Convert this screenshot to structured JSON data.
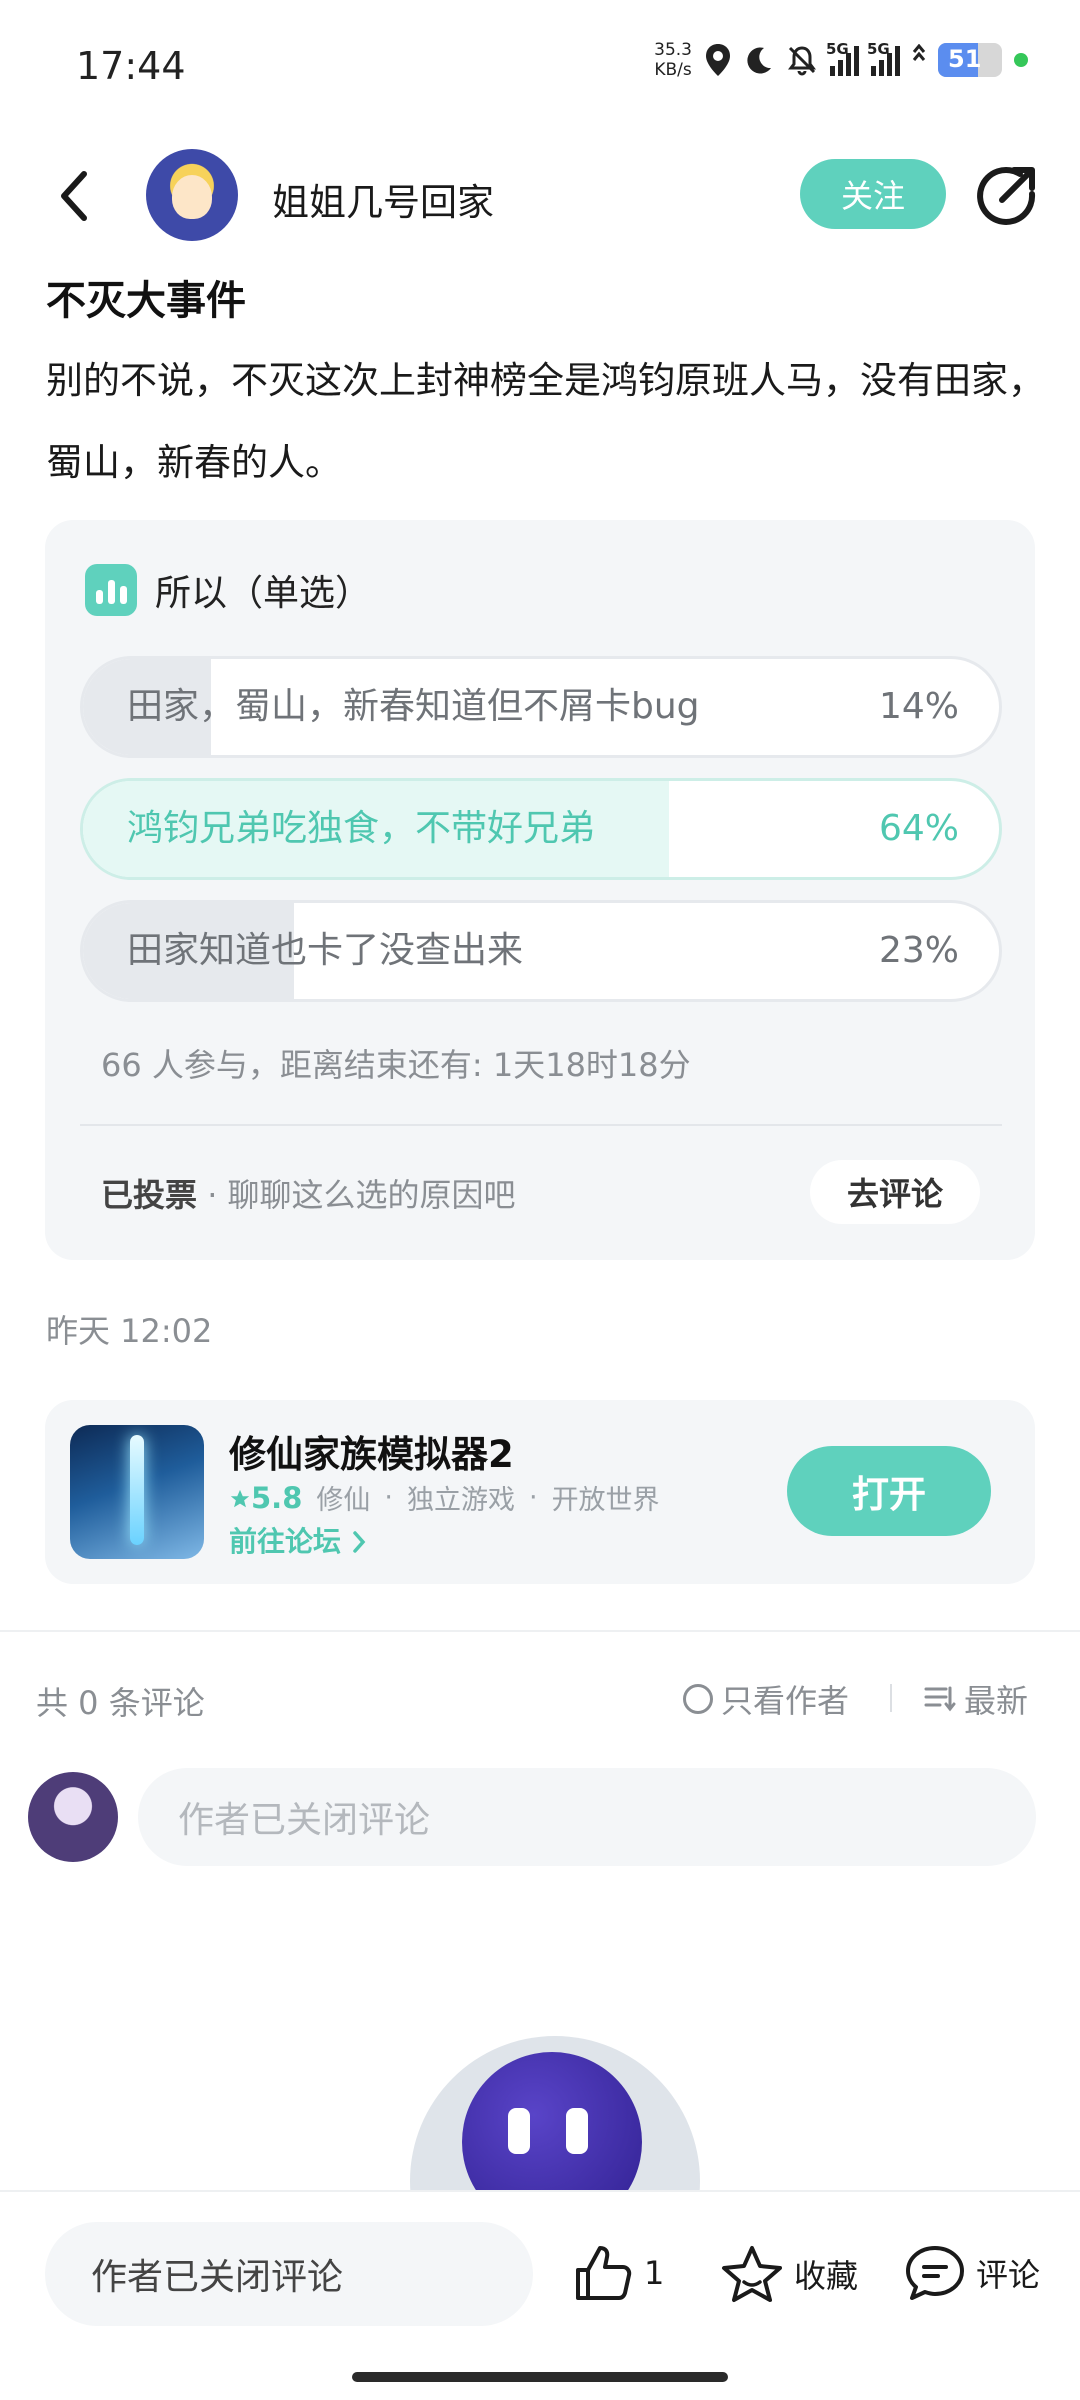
{
  "status_bar": {
    "time": "17:44",
    "net_speed_value": "35.3",
    "net_speed_unit": "KB/s",
    "sim1_type": "5G",
    "sim2_type": "5G",
    "battery_level": "51",
    "icons": [
      "location-icon",
      "moon-icon",
      "bell-off-icon",
      "signal-icon",
      "wifi-icon",
      "battery-icon"
    ]
  },
  "header": {
    "author_name": "姐姐几号回家",
    "follow_label": "关注"
  },
  "post": {
    "title": "不灭大事件",
    "body": "别的不说，不灭这次上封神榜全是鸿钧原班人马，没有田家，蜀山，新春的人。",
    "time": "昨天 12:02"
  },
  "poll": {
    "question": "所以（单选）",
    "options": [
      {
        "label": "田家，蜀山，新春知道但不屑卡bug",
        "percent": "14%",
        "share": 14,
        "selected": false
      },
      {
        "label": "鸿钧兄弟吃独食，不带好兄弟",
        "percent": "64%",
        "share": 64,
        "selected": true
      },
      {
        "label": "田家知道也卡了没查出来",
        "percent": "23%",
        "share": 23,
        "selected": false
      }
    ],
    "meta": "66 人参与，距离结束还有: 1天18时18分",
    "voted_label": "已投票",
    "voted_hint": " · 聊聊这么选的原因吧",
    "go_comment_label": "去评论"
  },
  "game": {
    "name": "修仙家族模拟器2",
    "rating": "5.8",
    "tags": [
      "修仙",
      "独立游戏",
      "开放世界"
    ],
    "tag_separator": "·",
    "forum_link": "前往论坛",
    "open_label": "打开"
  },
  "comments": {
    "count_label": "共 0 条评论",
    "author_only_label": "只看作者",
    "sort_label": "最新",
    "input_placeholder": "作者已关闭评论"
  },
  "bottom_bar": {
    "input_placeholder": "作者已关闭评论",
    "like_count": "1",
    "favorite_label": "收藏",
    "comment_label": "评论"
  },
  "colors": {
    "accent": "#5fd1bd",
    "accent_text": "#4fc7b0",
    "card_bg": "#f4f6f8",
    "muted_text": "#8a8e93"
  }
}
